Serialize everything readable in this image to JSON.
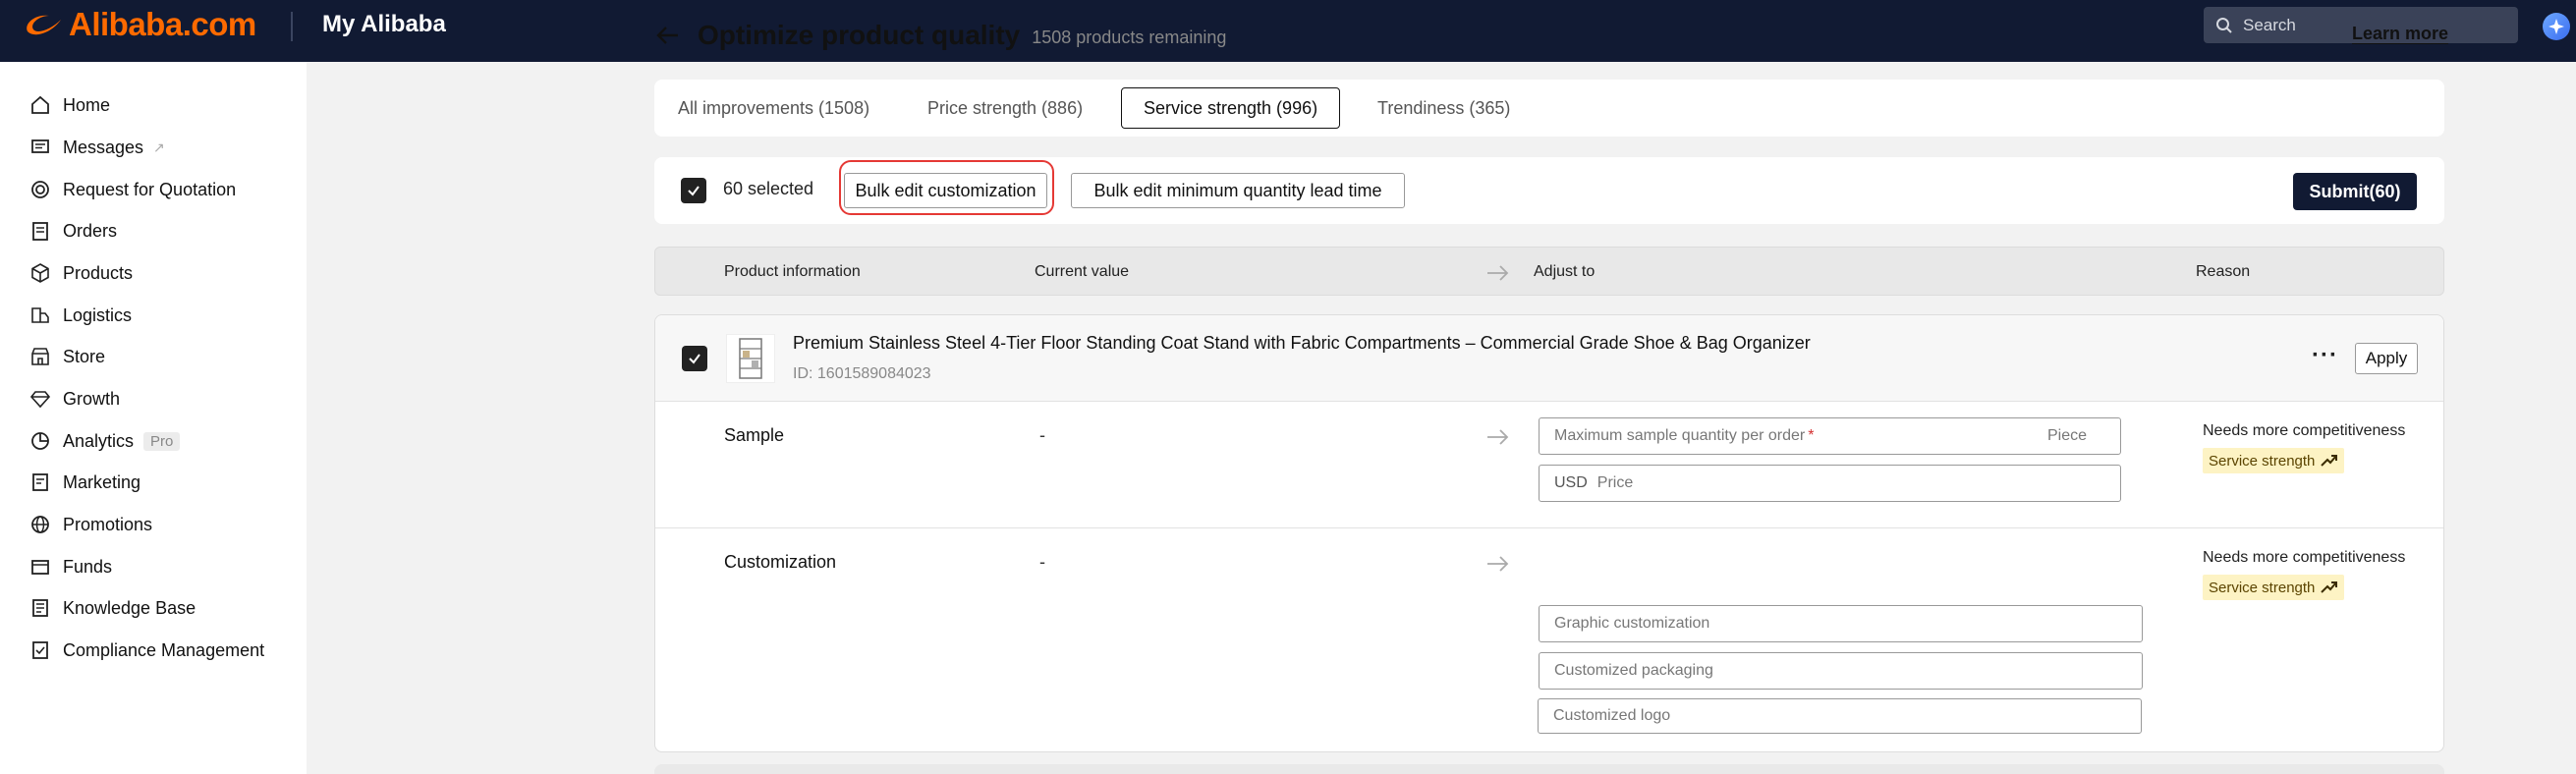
{
  "header": {
    "logo_text": "Alibaba.com",
    "section_title": "My Alibaba",
    "search_placeholder": "Search",
    "accent": "#ff6a00",
    "bg": "#111a33"
  },
  "sidebar": {
    "items": [
      {
        "label": "Home",
        "icon": "home-icon"
      },
      {
        "label": "Messages",
        "icon": "message-icon"
      },
      {
        "label": "Request for Quotation",
        "icon": "target-icon"
      },
      {
        "label": "Orders",
        "icon": "clipboard-icon"
      },
      {
        "label": "Products",
        "icon": "cube-icon"
      },
      {
        "label": "Logistics",
        "icon": "truck-icon"
      },
      {
        "label": "Store",
        "icon": "store-icon"
      },
      {
        "label": "Growth",
        "icon": "diamond-icon"
      },
      {
        "label": "Analytics",
        "icon": "chart-icon",
        "badge": "Pro"
      },
      {
        "label": "Marketing",
        "icon": "marketing-icon"
      },
      {
        "label": "Promotions",
        "icon": "globe-icon"
      },
      {
        "label": "Funds",
        "icon": "wallet-icon"
      },
      {
        "label": "Knowledge Base",
        "icon": "book-icon"
      },
      {
        "label": "Compliance Management",
        "icon": "compliance-icon"
      }
    ]
  },
  "page": {
    "title": "Optimize product quality",
    "remaining": "1508 products remaining",
    "learn_more": "Learn more"
  },
  "tabs": [
    {
      "label": "All improvements (1508)",
      "active": false
    },
    {
      "label": "Price strength (886)",
      "active": false
    },
    {
      "label": "Service strength (996)",
      "active": true
    },
    {
      "label": "Trendiness (365)",
      "active": false
    }
  ],
  "toolbar": {
    "selected": "60 selected",
    "bulk_customization": "Bulk edit customization",
    "bulk_moq": "Bulk edit minimum quantity lead time",
    "submit": "Submit(60)"
  },
  "table": {
    "headers": {
      "product": "Product information",
      "current": "Current value",
      "adjust": "Adjust to",
      "reason": "Reason"
    }
  },
  "product": {
    "title": "Premium Stainless Steel 4-Tier Floor Standing Coat Stand with Fabric Compartments – Commercial Grade Shoe & Bag Organizer",
    "id": "ID: 1601589084023",
    "apply": "Apply",
    "rows": [
      {
        "label": "Sample",
        "current": "-",
        "fields": {
          "max_sample": "Maximum sample quantity per order",
          "required_mark": "*",
          "unit": "Piece",
          "currency": "USD",
          "price": "Price"
        },
        "reason": "Needs more competitiveness",
        "tag": "Service strength"
      },
      {
        "label": "Customization",
        "current": "-",
        "fields": {
          "graphic": "Graphic customization",
          "packaging": "Customized packaging",
          "logo": "Customized logo"
        },
        "reason": "Needs more competitiveness",
        "tag": "Service strength"
      }
    ]
  }
}
